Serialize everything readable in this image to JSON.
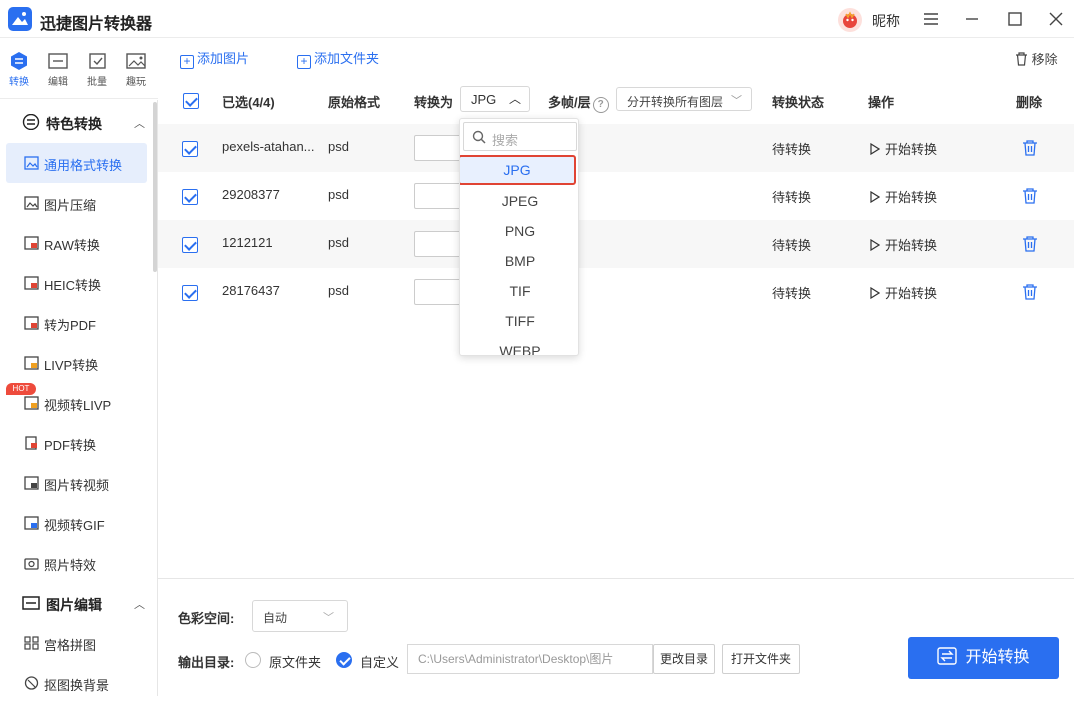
{
  "app": {
    "title": "迅捷图片转换器",
    "nickname": "昵称"
  },
  "top_tabs": [
    {
      "label": "转换",
      "icon": "convert-icon",
      "active": true
    },
    {
      "label": "编辑",
      "icon": "edit-icon"
    },
    {
      "label": "批量",
      "icon": "batch-icon"
    },
    {
      "label": "趣玩",
      "icon": "fun-icon"
    }
  ],
  "sidebar": {
    "section1": "特色转换",
    "items": [
      "通用格式转换",
      "图片压缩",
      "RAW转换",
      "HEIC转换",
      "转为PDF",
      "LIVP转换",
      "视频转LIVP",
      "PDF转换",
      "图片转视频",
      "视频转GIF",
      "照片特效"
    ],
    "hot_badge": "HOT",
    "section2": "图片编辑",
    "items2": [
      "宫格拼图",
      "抠图换背景"
    ]
  },
  "toolbar": {
    "add_image": "添加图片",
    "add_folder": "添加文件夹",
    "remove": "移除"
  },
  "table": {
    "headers": {
      "selected": "已选(4/4)",
      "orig_format": "原始格式",
      "convert_to": "转换为",
      "convert_value": "JPG",
      "multi_frame": "多帧/层",
      "layer_option": "分开转换所有图层",
      "status": "转换状态",
      "action": "操作",
      "delete": "删除"
    },
    "rows": [
      {
        "name": "pexels-atahan...",
        "format": "psd",
        "status": "待转换",
        "action": "开始转换"
      },
      {
        "name": "29208377",
        "format": "psd",
        "status": "待转换",
        "action": "开始转换"
      },
      {
        "name": "1212121",
        "format": "psd",
        "status": "待转换",
        "action": "开始转换"
      },
      {
        "name": "28176437",
        "format": "psd",
        "status": "待转换",
        "action": "开始转换"
      }
    ]
  },
  "dropdown": {
    "search_placeholder": "搜索",
    "options": [
      "JPG",
      "JPEG",
      "PNG",
      "BMP",
      "TIF",
      "TIFF",
      "WEBP"
    ],
    "selected": "JPG"
  },
  "bottom": {
    "color_space_label": "色彩空间:",
    "color_space_value": "自动",
    "output_label": "输出目录:",
    "opt_original": "原文件夹",
    "opt_custom": "自定义",
    "path": "C:\\Users\\Administrator\\Desktop\\图片",
    "change_dir": "更改目录",
    "open_folder": "打开文件夹",
    "start": "开始转换"
  },
  "colors": {
    "accent": "#2a6ff0",
    "highlight_border": "#e04434",
    "hot": "#ee4b3c"
  }
}
